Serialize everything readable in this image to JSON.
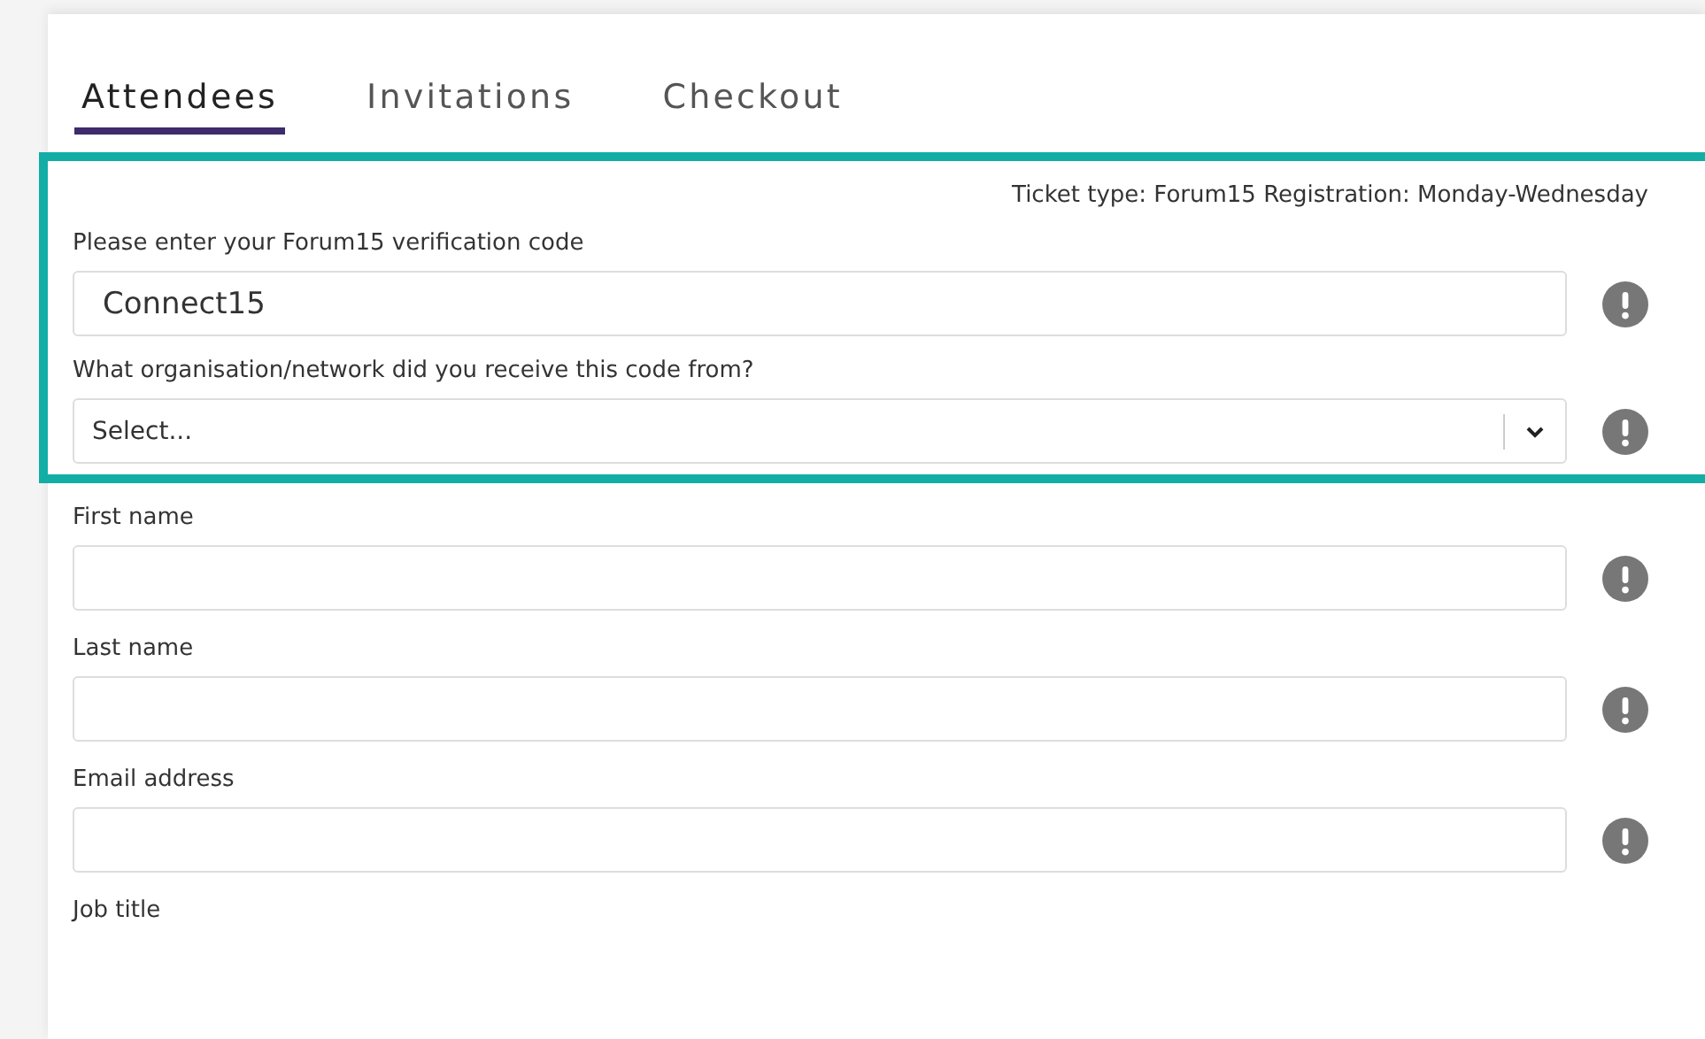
{
  "tabs": [
    {
      "label": "Attendees",
      "selected": true
    },
    {
      "label": "Invitations",
      "selected": false
    },
    {
      "label": "Checkout",
      "selected": false
    }
  ],
  "verification": {
    "ticket_type": "Ticket type: Forum15 Registration: Monday-Wednesday",
    "fields": [
      {
        "kind": "text",
        "label": "Please enter your Forum15 verification code",
        "value": "Connect15",
        "required": true
      },
      {
        "kind": "select",
        "label": "What organisation/network did you receive this code from?",
        "placeholder": "Select...",
        "required": true
      }
    ]
  },
  "fields": [
    {
      "kind": "text",
      "label": "First name",
      "required": true
    },
    {
      "kind": "text",
      "label": "Last name",
      "required": true
    },
    {
      "kind": "text",
      "label": "Email address",
      "required": true
    },
    {
      "kind": "label",
      "label": "Job title"
    }
  ]
}
